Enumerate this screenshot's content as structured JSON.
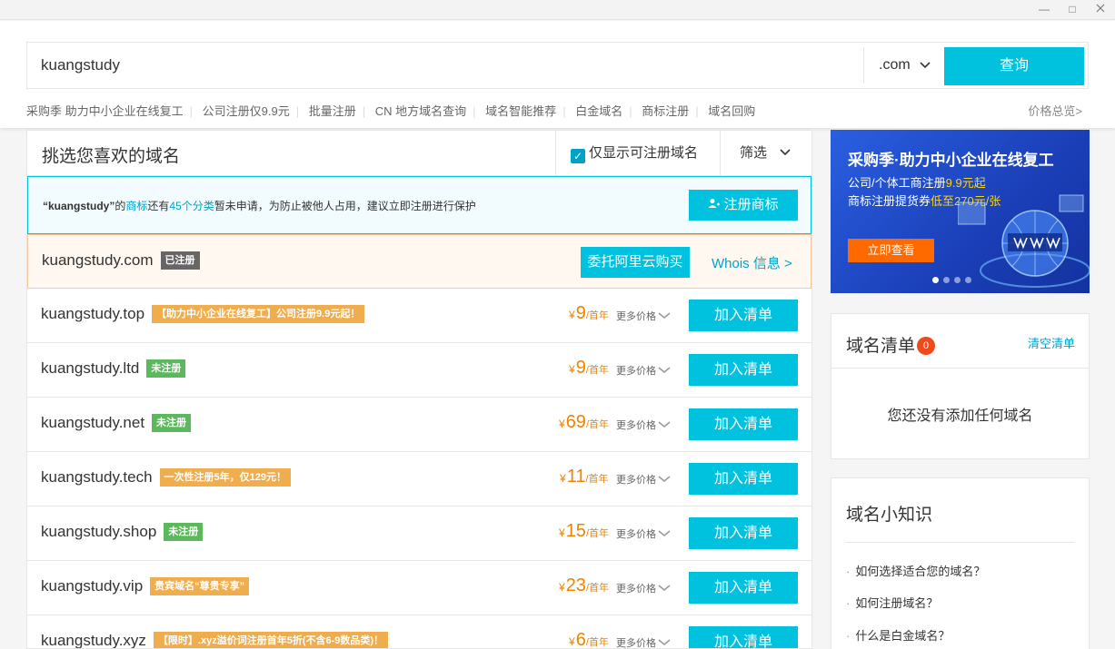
{
  "window": {
    "minimize": "—",
    "maximize": "□"
  },
  "search": {
    "value": "kuangstudy",
    "suffix": ".com",
    "button": "查询"
  },
  "quick_links": [
    "采购季 助力中小企业在线复工",
    "公司注册仅9.9元",
    "批量注册",
    "CN 地方域名查询",
    "域名智能推荐",
    "白金域名",
    "商标注册",
    "域名回购"
  ],
  "price_overview": "价格总览>",
  "main": {
    "title": "挑选您喜欢的域名",
    "only_available": "仅显示可注册域名",
    "filter": "筛选"
  },
  "trademark": {
    "name": "“kuangstudy”",
    "t1": "的",
    "link": "商标",
    "t2": "还有",
    "count": "45个分类",
    "t3": "暂未申请，为防止被他人占用，建议立即注册进行保护",
    "button": "注册商标"
  },
  "taken": {
    "domain": "kuangstudy.com",
    "badge": "已注册",
    "entrust": "委托阿里云购买",
    "whois": "Whois 信息 >"
  },
  "rows": [
    {
      "domain": "kuangstudy.top",
      "badge": "【助力中小企业在线复工】公司注册9.9元起！",
      "badge_color": "orange",
      "price": "9"
    },
    {
      "domain": "kuangstudy.ltd",
      "badge": "未注册",
      "badge_color": "green",
      "price": "9"
    },
    {
      "domain": "kuangstudy.net",
      "badge": "未注册",
      "badge_color": "green",
      "price": "69"
    },
    {
      "domain": "kuangstudy.tech",
      "badge": "一次性注册5年，仅129元！",
      "badge_color": "orange",
      "price": "11"
    },
    {
      "domain": "kuangstudy.shop",
      "badge": "未注册",
      "badge_color": "green",
      "price": "15"
    },
    {
      "domain": "kuangstudy.vip",
      "badge": "贵宾域名“尊贵专享”",
      "badge_color": "orange",
      "price": "23"
    },
    {
      "domain": "kuangstudy.xyz",
      "badge": "【限时】.xyz溢价词注册首年5折(不含6-9数品类)！",
      "badge_color": "orange",
      "price": "6"
    }
  ],
  "price_labels": {
    "yen": "¥",
    "per": "/首年",
    "more": "更多价格",
    "add": "加入清单"
  },
  "ad": {
    "title": "采购季·助力中小企业在线复工",
    "line1_prefix": "公司/个体工商注册",
    "line1_hl": "9.9元起",
    "line2_prefix": "商标注册提货券",
    "line2_hl": "低至270元/张",
    "button": "立即查看"
  },
  "cart": {
    "title": "域名清单",
    "count": "0",
    "clear": "清空清单",
    "empty": "您还没有添加任何域名"
  },
  "knowledge": {
    "title": "域名小知识",
    "items": [
      "如何选择适合您的域名？",
      "如何注册域名？",
      "什么是白金域名？"
    ]
  },
  "colors": {
    "accent": "#00c1de",
    "price": "#f08300",
    "badge_green": "#5cb85c",
    "badge_orange": "#f0ad4e",
    "badge_gray": "#666666"
  }
}
